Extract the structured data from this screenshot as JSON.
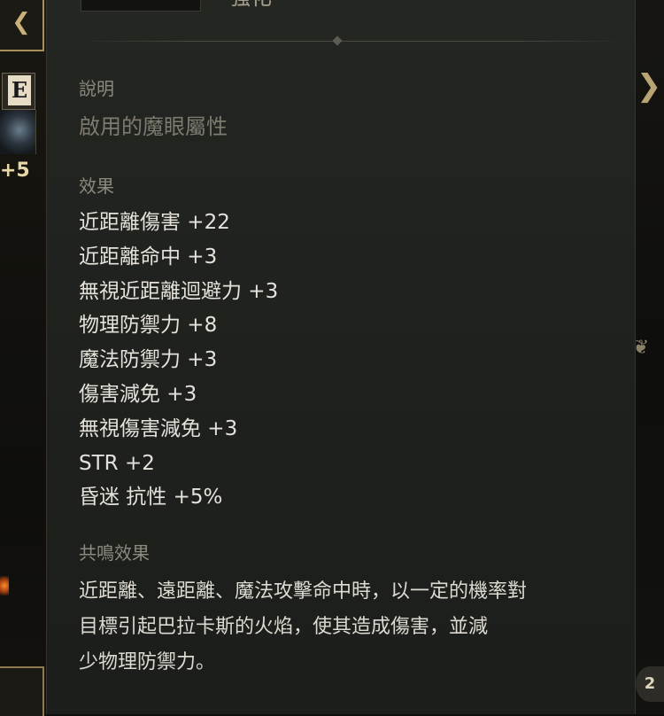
{
  "item": {
    "title": "強化"
  },
  "sections": {
    "description": {
      "label": "說明",
      "text": "啟用的魔眼屬性"
    },
    "effects": {
      "label": "效果",
      "lines": [
        "近距離傷害 +22",
        "近距離命中 +3",
        "無視近距離迴避力 +3",
        "物理防禦力 +8",
        "魔法防禦力 +3",
        "傷害減免 +3",
        "無視傷害減免 +3",
        "STR +2",
        "昏迷 抗性 +5%"
      ]
    },
    "resonance": {
      "label": "共鳴效果",
      "lines": [
        "近距離、遠距離、魔法攻擊命中時，以一定的機率對",
        "目標引起巴拉卡斯的火焰，使其造成傷害，並減",
        "少物理防禦力。"
      ]
    }
  },
  "left_panel": {
    "slot_letter": "E",
    "slot_level": "+5"
  },
  "right_panel": {
    "badge": "2"
  },
  "icons": {
    "nav_left": "chevron-left-icon",
    "nav_right": "chevron-right-icon",
    "gem": "magic-eye-gem-icon"
  },
  "colors": {
    "panel_bg": "#20221f",
    "section_label": "#8c8a7e",
    "body_text": "#e4e2da",
    "accent_gold": "#a8905a"
  }
}
